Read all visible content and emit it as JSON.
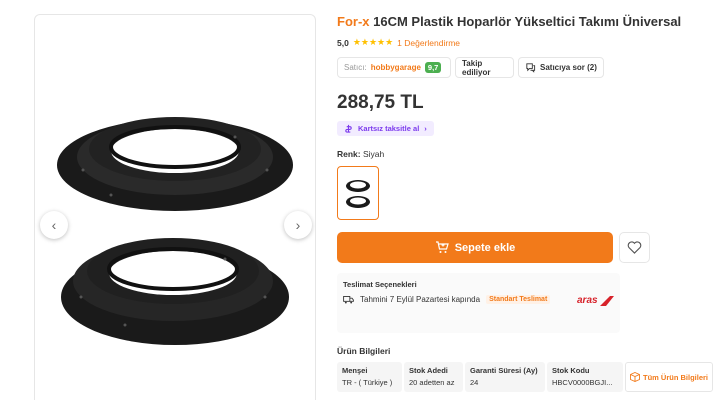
{
  "product": {
    "brand": "For-x",
    "name": "16CM Plastik Hoparlör Yükseltici Takımı Üniversal",
    "rating_score": "5,0",
    "stars": "★★★★★",
    "review_count": "1 Değerlendirme",
    "price": "288,75 TL"
  },
  "seller": {
    "label": "Satıcı:",
    "name": "hobbygarage",
    "score": "9,7",
    "follow_label": "Takip ediliyor",
    "ask_label": "Satıcıya sor (2)"
  },
  "installment": {
    "label": "Kartsız taksitle al",
    "chevron": "›"
  },
  "color": {
    "label": "Renk:",
    "value": "Siyah"
  },
  "gallery": {
    "prev_icon": "‹",
    "next_icon": "›"
  },
  "cart": {
    "label": "Sepete ekle"
  },
  "delivery": {
    "title": "Teslimat Seçenekleri",
    "estimate": "Tahmini 7 Eylül Pazartesi kapında",
    "tag": "Standart Teslimat",
    "carrier": "aras"
  },
  "specs": {
    "title": "Ürün Bilgileri",
    "items": [
      {
        "key": "Menşei",
        "value": "TR - ( Türkiye )"
      },
      {
        "key": "Stok Adedi",
        "value": "20 adetten az"
      },
      {
        "key": "Garanti Süresi (Ay)",
        "value": "24"
      },
      {
        "key": "Stok Kodu",
        "value": "HBCV0000BGJI..."
      }
    ],
    "all_label": "Tüm Ürün Bilgileri"
  },
  "colors": {
    "accent": "#f27a1a",
    "star": "#ffc000",
    "seller_score": "#4caf50",
    "installment": "#7c3aed",
    "carrier": "#d7222a"
  }
}
